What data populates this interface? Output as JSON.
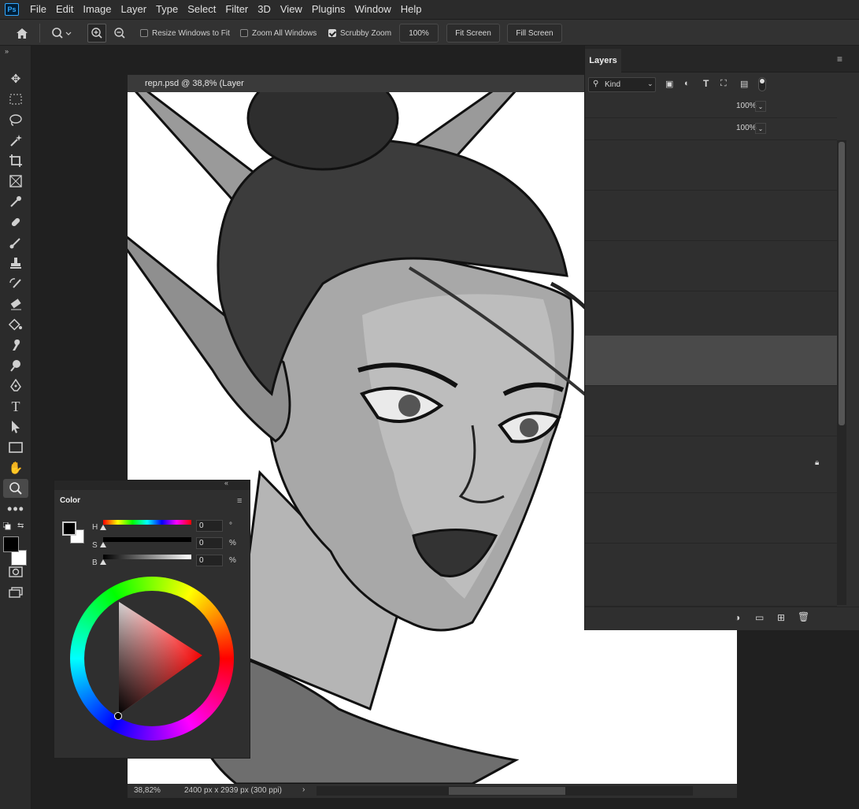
{
  "app": {
    "logo": "Ps"
  },
  "menu": [
    "File",
    "Edit",
    "Image",
    "Layer",
    "Type",
    "Select",
    "Filter",
    "3D",
    "View",
    "Plugins",
    "Window",
    "Help"
  ],
  "options": {
    "resize_windows": "Resize Windows to Fit",
    "zoom_all": "Zoom All Windows",
    "scrubby_zoom": "Scrubby Zoom",
    "zoom_value": "100%",
    "fit_screen": "Fit Screen",
    "fill_screen": "Fill Screen"
  },
  "document": {
    "tab_title": "repл.psd @ 38,8% (Layer",
    "zoom": "38,82%",
    "size": "2400 px x 2939 px (300 ppi)"
  },
  "layers": {
    "tab": "Layers",
    "filter_kind": "Kind",
    "opacity": "100%",
    "fill": "100%"
  },
  "color_panel": {
    "title": "Color",
    "h_label": "H",
    "h_value": "0",
    "h_unit": "°",
    "s_label": "S",
    "s_value": "0",
    "s_unit": "%",
    "b_label": "B",
    "b_value": "0",
    "b_unit": "%"
  },
  "colors": {
    "foreground": "#000000",
    "background": "#ffffff",
    "accent": "#31a8ff"
  }
}
